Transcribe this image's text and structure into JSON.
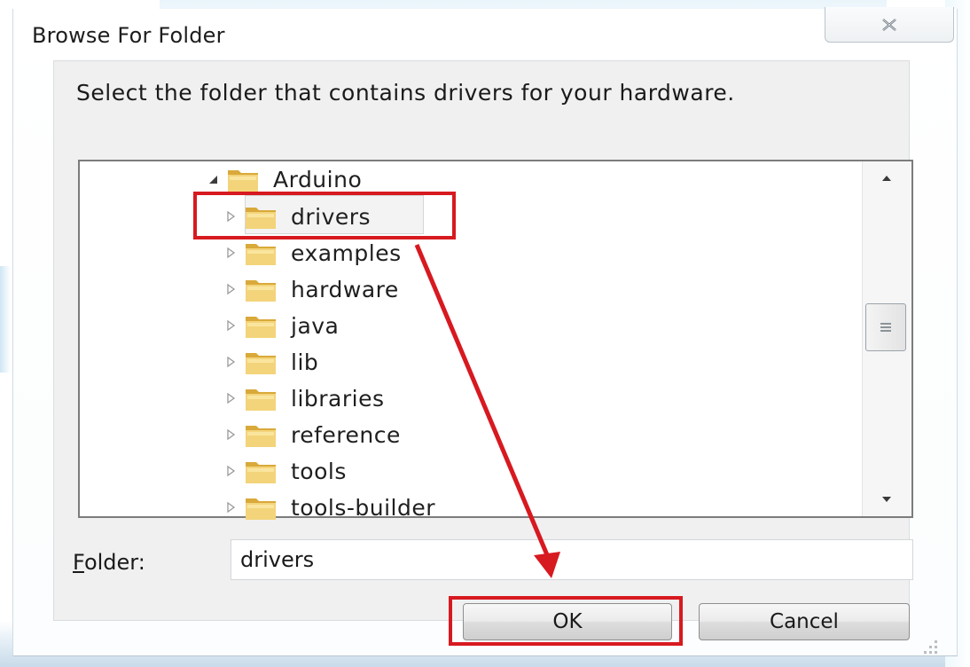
{
  "dialog": {
    "title": "Browse For Folder",
    "close_icon": "close-icon",
    "instruction": "Select the folder that contains drivers for your hardware."
  },
  "tree": {
    "parent": {
      "label": "Arduino",
      "expanded": true
    },
    "items": [
      {
        "label": "drivers",
        "selected": true
      },
      {
        "label": "examples"
      },
      {
        "label": "hardware"
      },
      {
        "label": "java"
      },
      {
        "label": "lib"
      },
      {
        "label": "libraries"
      },
      {
        "label": "reference"
      },
      {
        "label": "tools"
      },
      {
        "label": "tools-builder"
      }
    ]
  },
  "folder_field": {
    "label_prefix": "F",
    "label_rest": "older:",
    "value": "drivers"
  },
  "buttons": {
    "ok": "OK",
    "cancel": "Cancel"
  },
  "annotation": {
    "color": "#d71920"
  },
  "colors": {
    "folder_yellow": "#e8c15a",
    "tree_border": "#7c7c7c"
  }
}
